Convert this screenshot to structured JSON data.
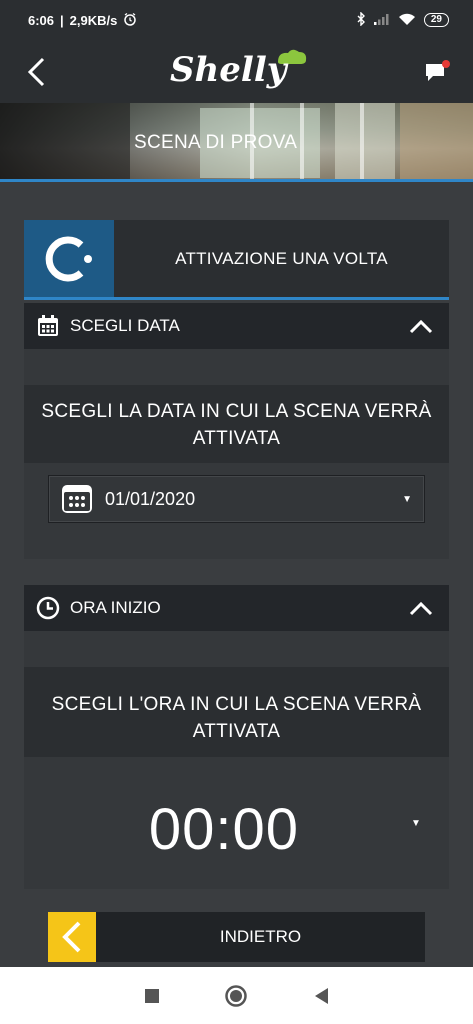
{
  "status_bar": {
    "time": "6:06",
    "network_speed": "2,9KB/s",
    "battery": "29",
    "icons": [
      "alarm-icon",
      "bluetooth-icon",
      "signal-icon",
      "wifi-icon",
      "battery-icon"
    ]
  },
  "header": {
    "logo_text": "Shelly",
    "back_icon": "chevron-left-icon",
    "chat_icon": "chat-notification-icon"
  },
  "banner": {
    "title": "SCENA DI PROVA"
  },
  "activation": {
    "label": "ATTIVAZIONE UNA VOLTA",
    "icon": "once-icon"
  },
  "date_section": {
    "header": "SCEGLI DATA",
    "prompt": "SCEGLI LA DATA IN CUI LA SCENA VERRÀ ATTIVATA",
    "value": "01/01/2020"
  },
  "time_section": {
    "header": "ORA INIZIO",
    "prompt": "SCEGLI L'ORA IN CUI LA SCENA VERRÀ ATTIVATA",
    "value": "00:00"
  },
  "footer": {
    "back_label": "INDIETRO"
  },
  "colors": {
    "accent_blue": "#2f86c8",
    "accent_yellow": "#f5c518",
    "background": "#3a3d40",
    "card": "#2b2e31"
  }
}
